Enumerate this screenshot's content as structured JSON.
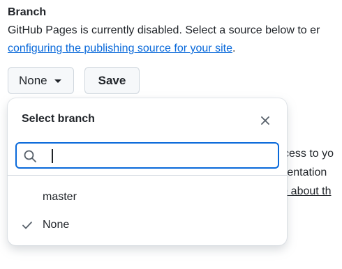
{
  "section": {
    "heading": "Branch",
    "description_line1": "GitHub Pages is currently disabled. Select a source below to er",
    "link_text": "configuring the publishing source for your site",
    "link_suffix": "."
  },
  "controls": {
    "branch_button_label": "None",
    "save_button_label": "Save"
  },
  "background_text": {
    "line1": "ccess to yo",
    "line2": "mentation",
    "line3": "re about th"
  },
  "menu": {
    "title": "Select branch",
    "search": {
      "value": "",
      "placeholder": ""
    },
    "options": [
      {
        "label": "master",
        "selected": false
      },
      {
        "label": "None",
        "selected": true
      }
    ]
  },
  "colors": {
    "accent": "#0969da",
    "border": "#d0d7de",
    "button_bg": "#f6f8fa",
    "text": "#1f2328"
  },
  "icons": {
    "close": "close-icon",
    "search": "search-icon",
    "check": "check-icon",
    "caret": "caret-down-icon"
  }
}
